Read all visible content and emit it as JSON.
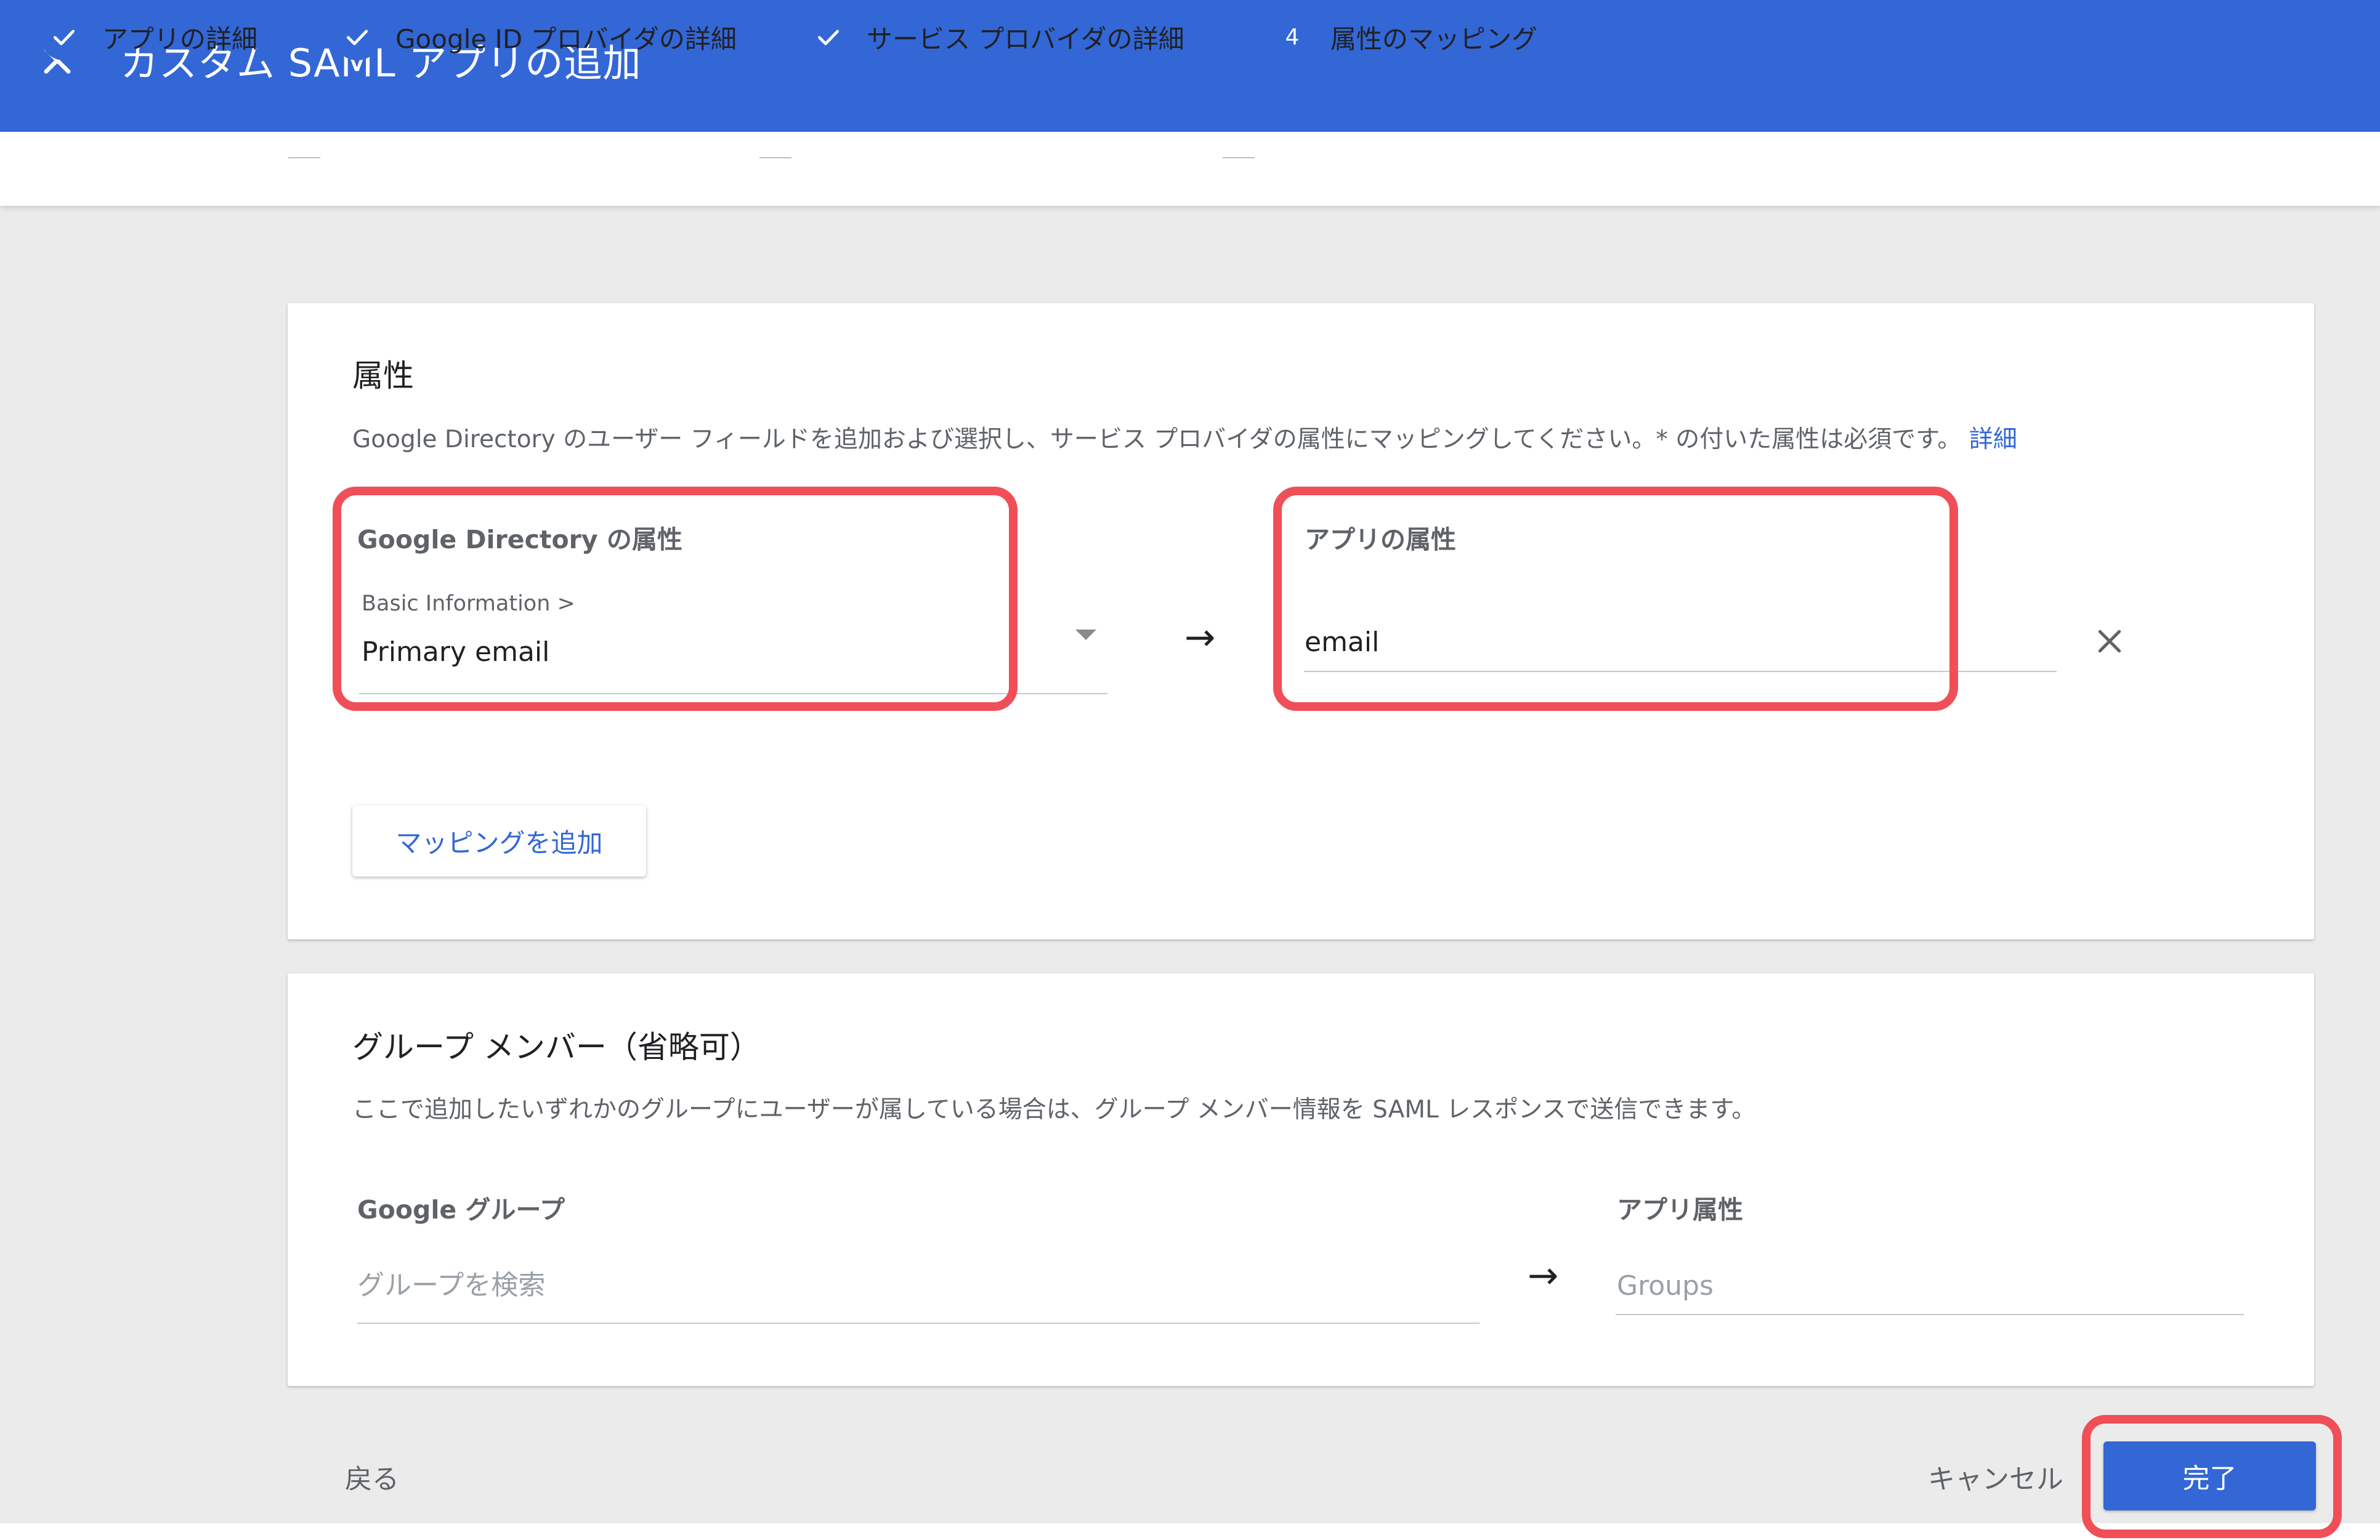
{
  "header": {
    "title": "カスタム SAML アプリの追加",
    "close_icon": "close-icon"
  },
  "stepper": {
    "steps": [
      {
        "label": "アプリの詳細",
        "state": "done",
        "icon": "check-icon"
      },
      {
        "label": "Google ID プロバイダの詳細",
        "state": "done",
        "icon": "check-icon"
      },
      {
        "label": "サービス プロバイダの詳細",
        "state": "done",
        "icon": "check-icon"
      },
      {
        "label": "属性のマッピング",
        "state": "active",
        "number": "4"
      }
    ]
  },
  "attributes": {
    "title": "属性",
    "description": "Google Directory のユーザー フィールドを追加および選択し、サービス プロバイダの属性にマッピングしてください。* の付いた属性は必須です。",
    "details_link": "詳細",
    "directory_label": "Google Directory の属性",
    "directory_category": "Basic Information >",
    "directory_value": "Primary email",
    "app_label": "アプリの属性",
    "app_value": "email",
    "arrow": "→",
    "add_mapping_button": "マッピングを追加"
  },
  "group_members": {
    "title": "グループ メンバー（省略可）",
    "description": "ここで追加したいずれかのグループにユーザーが属している場合は、グループ メンバー情報を SAML レスポンスで送信できます。",
    "google_group_label": "Google グループ",
    "google_group_placeholder": "グループを検索",
    "app_attribute_label": "アプリ属性",
    "app_attribute_placeholder": "Groups",
    "arrow": "→"
  },
  "footer": {
    "back_label": "戻る",
    "cancel_label": "キャンセル",
    "done_label": "完了"
  },
  "colors": {
    "primary": "#3367d6",
    "highlight": "#f04f58",
    "background": "#ebebeb"
  }
}
